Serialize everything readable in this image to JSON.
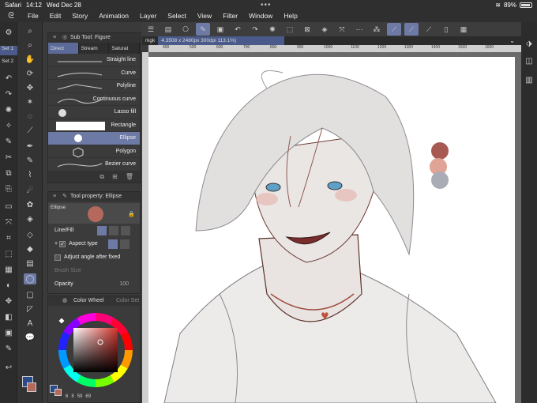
{
  "status": {
    "app": "Safari",
    "time": "14:12",
    "date": "Wed Dec 28",
    "battery": "89%"
  },
  "menu": [
    "File",
    "Edit",
    "Story",
    "Animation",
    "Layer",
    "Select",
    "View",
    "Filter",
    "Window",
    "Help"
  ],
  "sets": [
    "Set 1",
    "Set 2"
  ],
  "subtool": {
    "title": "Sub Tool: Figure",
    "tabs": [
      "Direct",
      "Stream",
      "Saturat"
    ],
    "items": [
      "Straight line",
      "Curve",
      "Polyline",
      "Continuous curve",
      "Lasso fill",
      "Rectangle",
      "Ellipse",
      "Polygon",
      "Bezier curve"
    ],
    "selected": "Ellipse"
  },
  "property": {
    "title": "Tool property: Ellipse",
    "name": "Ellipse",
    "line_fill": "Line/Fill",
    "aspect_type": "Aspect type",
    "adjust_angle": "Adjust angle after fixed",
    "brush_size": "Brush Size",
    "opacity": "Opacity",
    "opacity_value": "100"
  },
  "colorwheel": {
    "title": "Color Wheel",
    "tab2": "Color Set",
    "values": [
      "6",
      "8",
      "59",
      "69"
    ],
    "main_color": "#b36a5c"
  },
  "canvas": {
    "tab_name": "rkgk",
    "tab_info": "4.3508 x 2480px 300dpi 113.1%)",
    "ruler_ticks": [
      "400",
      "500",
      "600",
      "700",
      "800",
      "900",
      "1000",
      "1100",
      "1200",
      "1300",
      "1400",
      "1500",
      "1600"
    ]
  },
  "palette": [
    "#a65a52",
    "#e0a395",
    "#a9acb5"
  ],
  "colors": {
    "accent": "#6d7aa6",
    "panel": "#3b3b3b",
    "dark": "#2c2c2c"
  }
}
